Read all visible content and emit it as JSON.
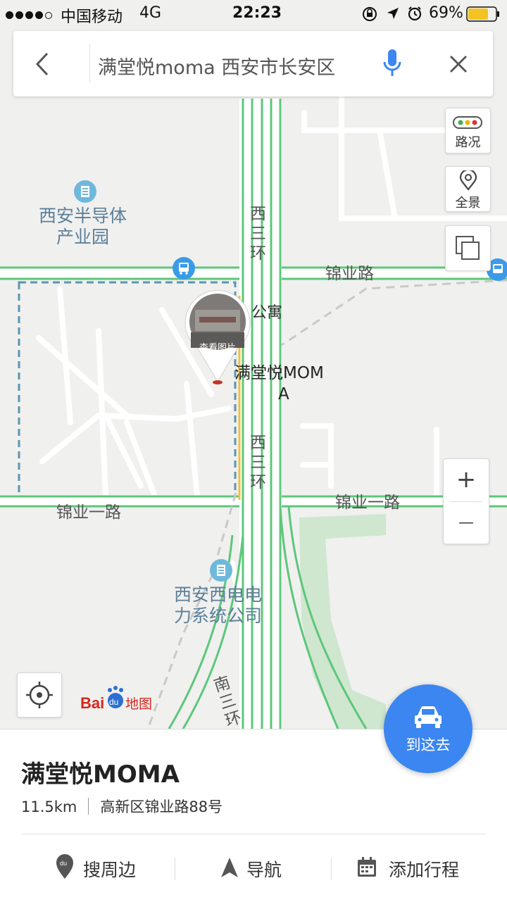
{
  "status_bar": {
    "carrier": "中国移动",
    "network": "4G",
    "time": "22:23",
    "battery": "69%"
  },
  "search": {
    "query": "满堂悦moma 西安市长安区"
  },
  "controls": {
    "traffic_label": "路况",
    "panorama_label": "全景",
    "zoom_in": "+",
    "zoom_out": "—"
  },
  "map": {
    "poi_semiconductor": [
      "西安半导体",
      "产业园"
    ],
    "poi_power": [
      "西安西电电",
      "力系统公司"
    ],
    "road_jinye": "锦业路",
    "road_jinye1_left": "锦业一路",
    "road_jinye1_right": "锦业一路",
    "ring_west_top": [
      "西",
      "三",
      "环"
    ],
    "ring_west_mid": [
      "西",
      "三",
      "环"
    ],
    "ring_south": [
      "南",
      "三",
      "环"
    ],
    "apartment": "公寓",
    "marker_label_line1": "满堂悦MOM",
    "marker_label_line2": "A",
    "photo_caption": "查看图片",
    "logo_text": "Baidu地图"
  },
  "place": {
    "name": "满堂悦MOMA",
    "distance": "11.5km",
    "address": "高新区锦业路88号",
    "actions": {
      "nearby": "搜周边",
      "navigate": "导航",
      "add_trip": "添加行程"
    },
    "goto_label": "到这去"
  },
  "colors": {
    "accent": "#3b86f0",
    "road_green": "#4cc46f",
    "poi": "#5c7f98",
    "battery": "#f3c324"
  }
}
